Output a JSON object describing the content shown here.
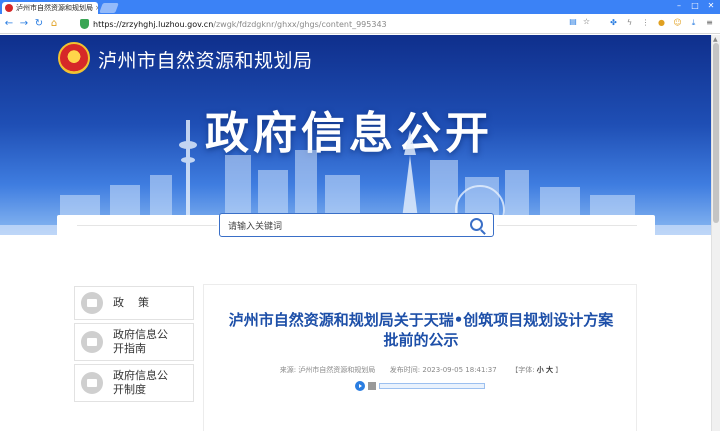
{
  "browser": {
    "tab_title": "泸州市自然资源和规划局",
    "tab_close": "×",
    "url_scheme": "https://",
    "url_host": "zrzyhghj.luzhou.gov.cn",
    "url_path": "/zwgk/fdzdgknr/ghxx/ghgs/content_995343",
    "icons": [
      "back-icon",
      "forward-icon",
      "refresh-icon",
      "home-icon",
      "shield-icon",
      "reader-icon",
      "star-icon",
      "extension-icon",
      "download-icon"
    ]
  },
  "header": {
    "bureau_name": "泸州市自然资源和规划局",
    "banner_title": "政府信息公开"
  },
  "search": {
    "placeholder": "请输入关键词"
  },
  "sidebar": {
    "items": [
      {
        "label": "政策"
      },
      {
        "label": "政府信息公开指南"
      },
      {
        "label": "政府信息公开制度"
      }
    ]
  },
  "article": {
    "title": "泸州市自然资源和规划局关于天瑞•创筑项目规划设计方案批前的公示",
    "source_label": "来源:",
    "source": "泸州市自然资源和规划局",
    "time_label": "发布时间:",
    "time": "2023-09-05 18:41:37",
    "font_label": "【字体:",
    "font_small": "小",
    "font_large": "大",
    "font_close": "】"
  },
  "colors": {
    "banner_top": "#0f2f8c",
    "accent": "#1d4fa8",
    "search_border": "#3a6fc7"
  }
}
